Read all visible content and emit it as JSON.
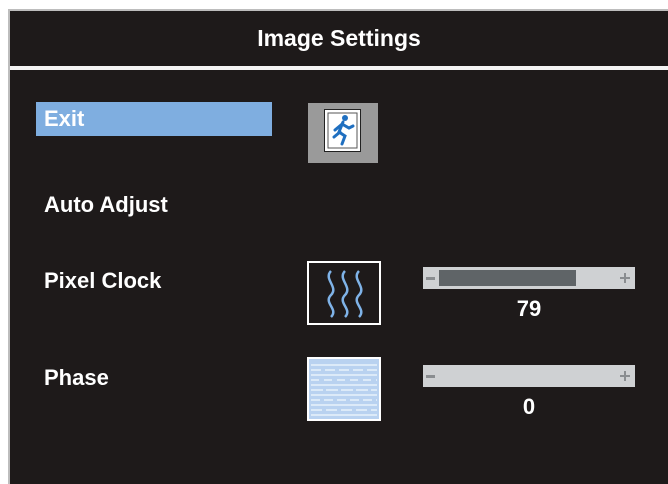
{
  "window": {
    "title": "Image Settings"
  },
  "menu": {
    "exit": {
      "label": "Exit",
      "icon": "exit-icon"
    },
    "auto_adjust": {
      "label": "Auto Adjust"
    },
    "pixel_clock": {
      "label": "Pixel Clock",
      "icon": "pixel-clock-icon",
      "value": "79",
      "level": 79
    },
    "phase": {
      "label": "Phase",
      "icon": "phase-icon",
      "value": "0",
      "level": 0
    }
  },
  "colors": {
    "background": "#1e1a1a",
    "selected": "#7faee0",
    "slider_track": "#cfd1d3",
    "slider_fill": "#5f6467"
  }
}
